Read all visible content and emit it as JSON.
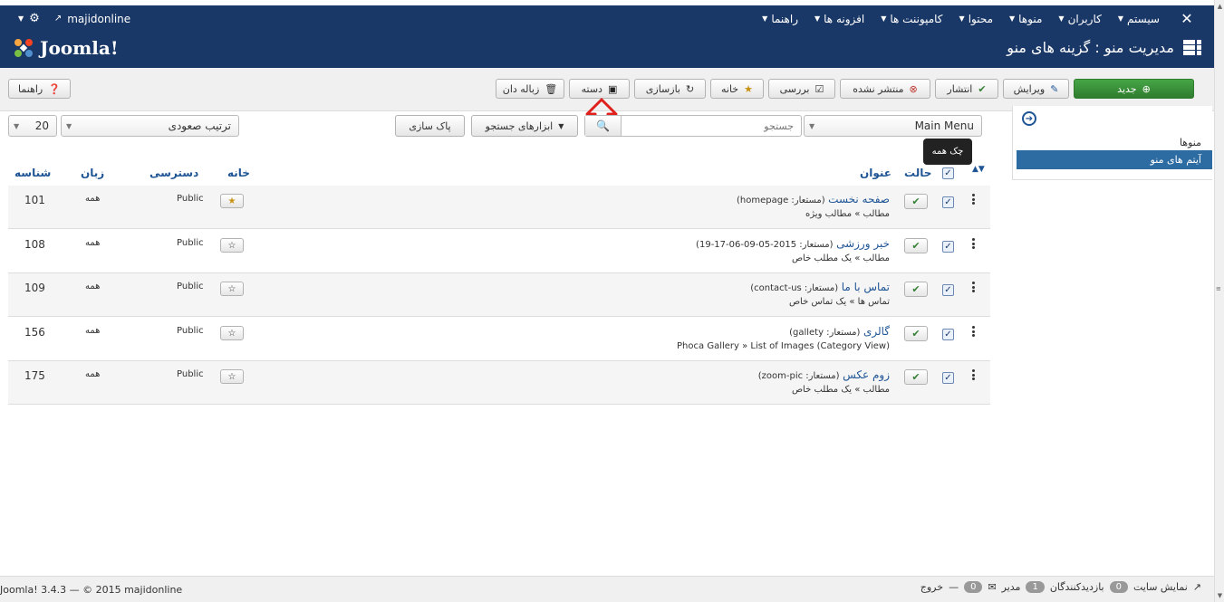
{
  "topbar": {
    "menus": [
      "سیستم",
      "کاربران",
      "منوها",
      "محتوا",
      "کامپوننت ها",
      "افزونه ها",
      "راهنما"
    ],
    "site_name": "majidonline"
  },
  "header": {
    "logo_text": "Joomla!",
    "title": "مدیریت منو : گزینه های منو"
  },
  "toolbar": {
    "new": "جدید",
    "edit": "ویرایش",
    "publish": "انتشار",
    "unpublish": "منتشر نشده",
    "checkin": "بررسی",
    "home": "خانه",
    "rebuild": "بازسازی",
    "batch": "دسته",
    "trash": "زباله دان",
    "help": "راهنما"
  },
  "sidebar": {
    "section": "منوها",
    "active_item": "آیتم های منو"
  },
  "filters": {
    "menu_select": "Main Menu",
    "search_placeholder": "جستجو",
    "search_tools": "ابزارهای جستجو",
    "clear": "پاک سازی",
    "order_select": "ترتیب صعودی",
    "limit_select": "20"
  },
  "tooltip": "چک همه",
  "table": {
    "headers": {
      "status": "حالت",
      "title": "عنوان",
      "home": "خانه",
      "access": "دسترسی",
      "language": "زبان",
      "id": "شناسه"
    },
    "rows": [
      {
        "title": "صفحه نخست",
        "alias": "(مستعار: homepage)",
        "type": "مطالب » مطالب ویژه",
        "access": "Public",
        "language": "همه",
        "id": "101",
        "home": true
      },
      {
        "title": "خبر ورزشی",
        "alias": "(مستعار: 2015-05-09-06-17-19)",
        "type": "مطالب » یک مطلب خاص",
        "access": "Public",
        "language": "همه",
        "id": "108",
        "home": false
      },
      {
        "title": "تماس با ما",
        "alias": "(مستعار: contact-us)",
        "type": "تماس ها » یک تماس خاص",
        "access": "Public",
        "language": "همه",
        "id": "109",
        "home": false
      },
      {
        "title": "گالری",
        "alias": "(مستعار: gallety)",
        "type": "Phoca Gallery » List of Images (Category View)",
        "access": "Public",
        "language": "همه",
        "id": "156",
        "home": false
      },
      {
        "title": "زوم عکس",
        "alias": "(مستعار: zoom-pic)",
        "type": "مطالب » یک مطلب خاص",
        "access": "Public",
        "language": "همه",
        "id": "175",
        "home": false
      }
    ]
  },
  "footer": {
    "view_site": "نمایش سایت",
    "visitors_count": "0",
    "visitors_label": "بازدیدکنندگان",
    "admin_count": "1",
    "admin_label": "مدیر",
    "messages_count": "0",
    "logout": "خروج",
    "copyright": "Joomla! 3.4.3 — © 2015 majidonline"
  }
}
